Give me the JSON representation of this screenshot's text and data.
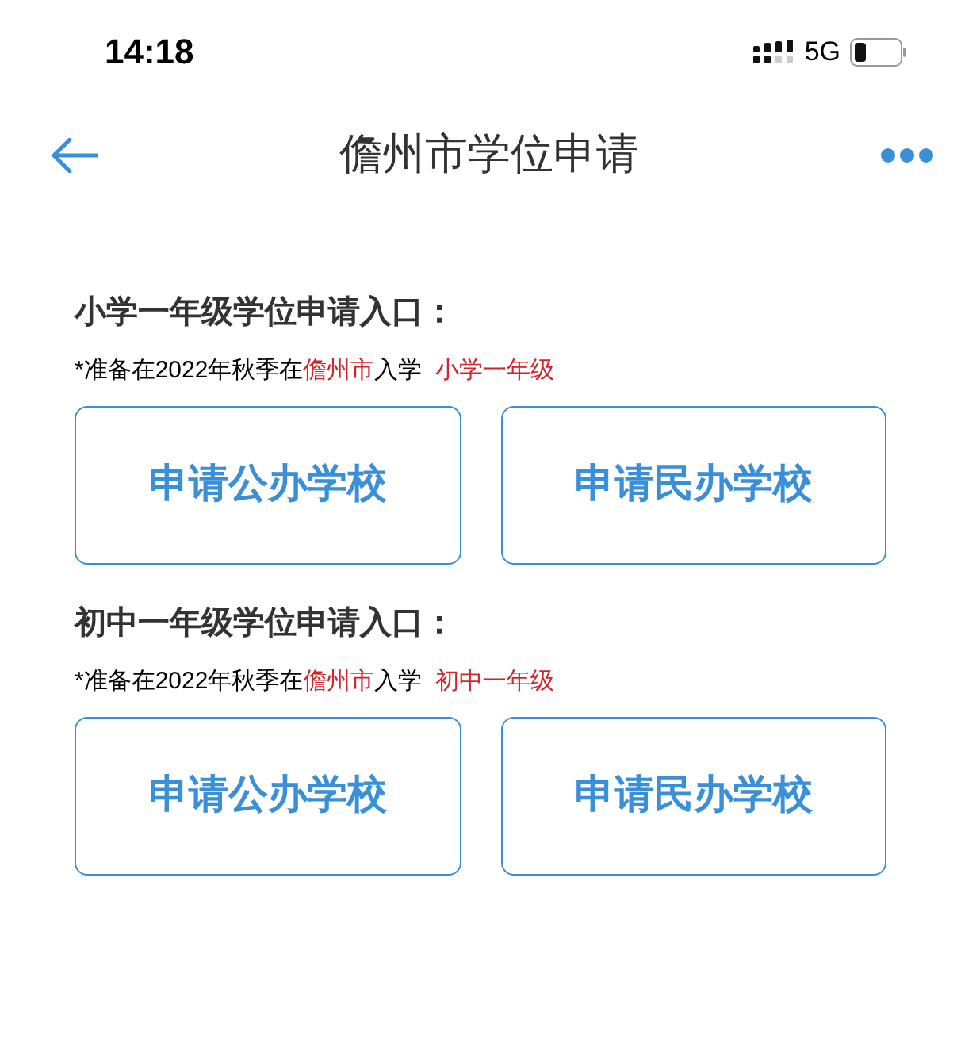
{
  "status_bar": {
    "time": "14:18",
    "network": "5G"
  },
  "nav": {
    "title": "儋州市学位申请"
  },
  "sections": [
    {
      "heading": "小学一年级学位申请入口：",
      "note": [
        {
          "text": "*准备在2022年秋季在",
          "highlight": false
        },
        {
          "text": "儋州市",
          "highlight": true
        },
        {
          "text": "入学  ",
          "highlight": false
        },
        {
          "text": "小学一年级",
          "highlight": true
        }
      ],
      "buttons": [
        "申请公办学校",
        "申请民办学校"
      ]
    },
    {
      "heading": "初中一年级学位申请入口：",
      "note": [
        {
          "text": "*准备在2022年秋季在",
          "highlight": false
        },
        {
          "text": "儋州市",
          "highlight": true
        },
        {
          "text": "入学  ",
          "highlight": false
        },
        {
          "text": "初中一年级",
          "highlight": true
        }
      ],
      "buttons": [
        "申请公办学校",
        "申请民办学校"
      ]
    }
  ]
}
